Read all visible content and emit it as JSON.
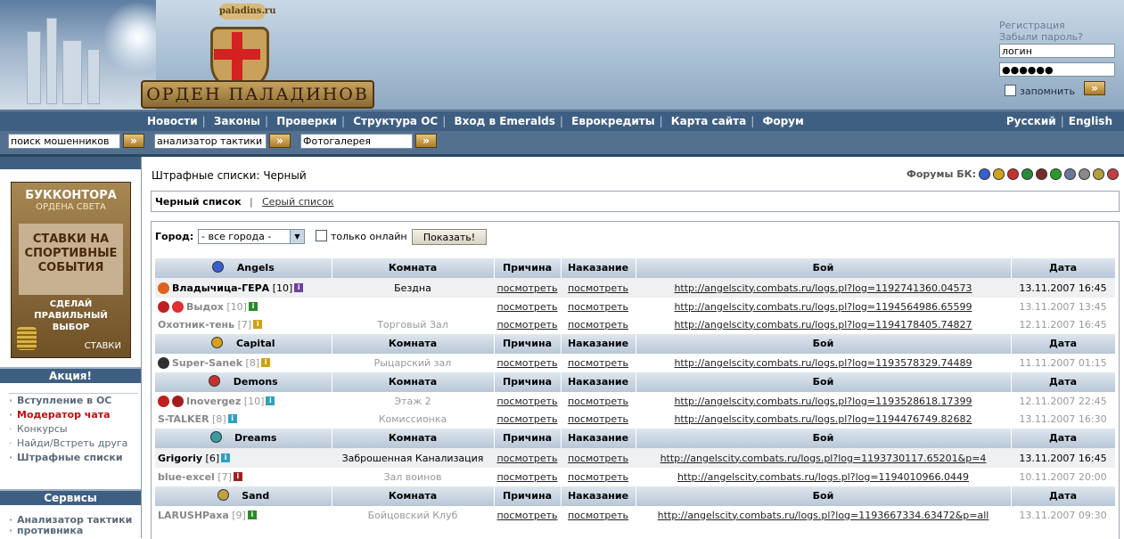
{
  "header": {
    "site_badge": "paladins.ru",
    "logo_text": "ОРДЕН ПАЛАДИНОВ",
    "register_link": "Регистрация",
    "forgot_link": "Забыли пароль?",
    "login_value": "логин",
    "password_value": "●●●●●●",
    "remember_label": "запомнить",
    "go_label": "»"
  },
  "nav": {
    "items": [
      "Новости",
      "Законы",
      "Проверки",
      "Структура ОС",
      "Вход в Emeralds",
      "Еврокредиты",
      "Карта сайта",
      "Форум"
    ],
    "lang": [
      "Русский",
      "English"
    ]
  },
  "searchbar": {
    "fraud_value": "поиск мошенников",
    "tactics_value": "анализатор тактики",
    "photo_value": "Фотогалерея"
  },
  "sidebar": {
    "promo": {
      "title": "БУККОНТОРА",
      "subtitle": "ОРДЕНА СВЕТА",
      "main": "СТАВКИ НА СПОРТИВНЫЕ СОБЫТИЯ",
      "slogan": "СДЕЛАЙ ПРАВИЛЬНЫЙ ВЫБОР",
      "footer": "СТАВКИ"
    },
    "action_head": "Акция!",
    "action_items": [
      "Вступление в ОС",
      "Модератор чата",
      "Конкурсы",
      "Найди/Встреть друга",
      "Штрафные списки"
    ],
    "services_head": "Сервисы",
    "services_items": [
      "Анализатор тактики",
      "противника"
    ]
  },
  "main": {
    "title": "Штрафные списки: Черный",
    "forums_label": "Форумы БК:",
    "forum_icon_colors": [
      "#3a5fcf",
      "#d4a020",
      "#c83030",
      "#2a8a3a",
      "#7a2a2a",
      "#2a9a2a",
      "#6a7a9a",
      "#8a8a8a",
      "#b0a040",
      "#c04040"
    ],
    "tab_black": "Черный список",
    "tab_sep": "|",
    "tab_gray": "Серый список",
    "city_label": "Город:",
    "city_value": "- все города -",
    "online_label": "только онлайн",
    "show_button": "Показать!"
  },
  "columns": {
    "room": "Комната",
    "reason": "Причина",
    "punishment": "Наказание",
    "battle": "Бой",
    "date": "Дата"
  },
  "link_text": "посмотреть",
  "groups": [
    {
      "city": "Angels",
      "rows": [
        {
          "nick": "Владычица-ГЕРА",
          "level": "[10]",
          "room": "Бездна",
          "battle": "http://angelscity.combats.ru/logs.pl?log=1192741360.04573",
          "date": "13.11.2007 16:45"
        },
        {
          "nick": "Выдох",
          "level": "[10]",
          "room": "",
          "battle": "http://angelscity.combats.ru/logs.pl?log=1194564986.65599",
          "date": "13.11.2007 13:45"
        },
        {
          "nick": "Охотник-тень",
          "level": "[7]",
          "room": "Торговый Зал",
          "battle": "http://angelscity.combats.ru/logs.pl?log=1194178405.74827",
          "date": "12.11.2007 16:45"
        }
      ]
    },
    {
      "city": "Capital",
      "rows": [
        {
          "nick": "Super-Sanek",
          "level": "[8]",
          "room": "Рыцарский зал",
          "battle": "http://angelscity.combats.ru/logs.pl?log=1193578329.74489",
          "date": "11.11.2007 01:15"
        }
      ]
    },
    {
      "city": "Demons",
      "rows": [
        {
          "nick": "Inovergez",
          "level": "[10]",
          "room": "Этаж 2",
          "battle": "http://angelscity.combats.ru/logs.pl?log=1193528618.17399",
          "date": "12.11.2007 22:45"
        },
        {
          "nick": "S-TALKER",
          "level": "[8]",
          "room": "Комиссионка",
          "battle": "http://angelscity.combats.ru/logs.pl?log=1194476749.82682",
          "date": "13.11.2007 16:30"
        }
      ]
    },
    {
      "city": "Dreams",
      "rows": [
        {
          "nick": "Grigoriy",
          "level": "[6]",
          "room": "Заброшенная Канализация",
          "battle": "http://angelscity.combats.ru/logs.pl?log=1193730117.65201&p=4",
          "date": "13.11.2007 16:45"
        },
        {
          "nick": "blue-excel",
          "level": "[7]",
          "room": "Зал воинов",
          "battle": "http://angelscity.combats.ru/logs.pl?log=1194010966.0449",
          "date": "10.11.2007 20:00"
        }
      ]
    },
    {
      "city": "Sand",
      "rows": [
        {
          "nick": "LARUSHPaxa",
          "level": "[9]",
          "room": "Бойцовский Клуб",
          "battle": "http://angelscity.combats.ru/logs.pl?log=1193667334.63472&p=all",
          "date": "13.11.2007 09:30"
        }
      ]
    }
  ]
}
